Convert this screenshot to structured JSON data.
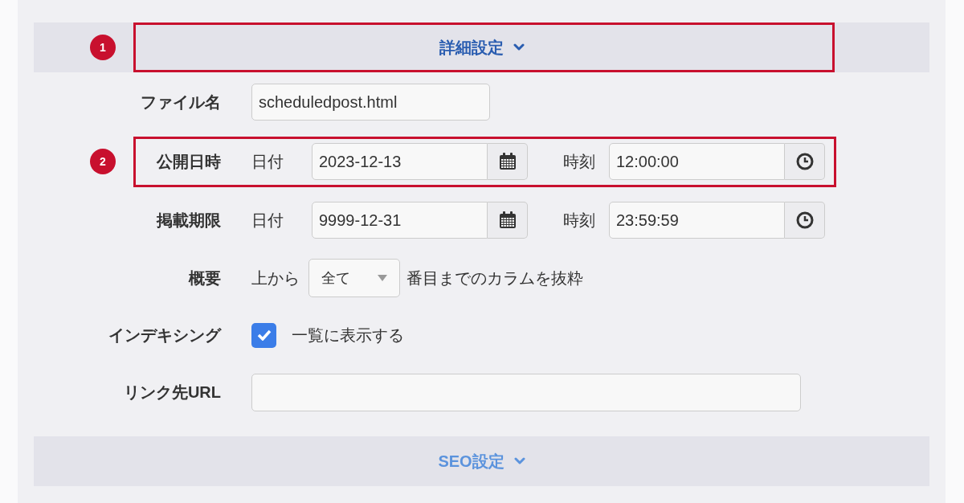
{
  "sections": [
    {
      "title": "詳細設定",
      "expanded": false,
      "color": "#2a5db0",
      "annotation": "1"
    },
    {
      "title": "SEO設定",
      "expanded": false,
      "color": "#5b93dd"
    }
  ],
  "rows": [
    {
      "kind": "text",
      "label": "ファイル名",
      "value": "scheduledpost.html"
    },
    {
      "kind": "datetime",
      "label": "公開日時",
      "annotation": "2",
      "date_label": "日付",
      "date": "2023-12-13",
      "time_label": "時刻",
      "time": "12:00:00"
    },
    {
      "kind": "datetime",
      "label": "掲載期限",
      "date_label": "日付",
      "date": "9999-12-31",
      "time_label": "時刻",
      "time": "23:59:59"
    },
    {
      "kind": "select",
      "label": "概要",
      "prefix": "上から",
      "value": "全て",
      "suffix": "番目までのカラムを抜粋"
    },
    {
      "kind": "checkbox",
      "label": "インデキシング",
      "checked": true,
      "text": "一覧に表示する"
    },
    {
      "kind": "url",
      "label": "リンク先URL",
      "value": ""
    }
  ]
}
